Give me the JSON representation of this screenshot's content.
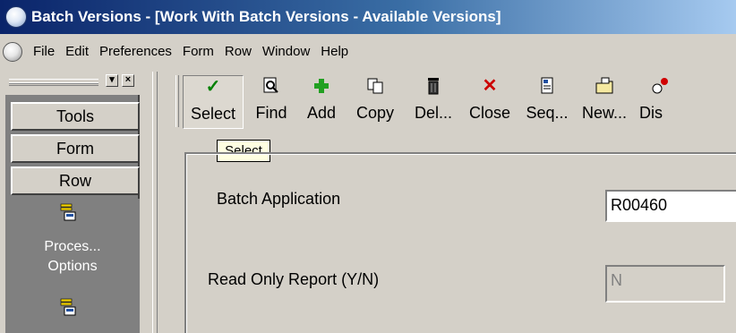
{
  "window": {
    "title": "Batch Versions - [Work With Batch Versions - Available Versions]"
  },
  "menubar": {
    "items": [
      "File",
      "Edit",
      "Preferences",
      "Form",
      "Row",
      "Window",
      "Help"
    ]
  },
  "left_panel": {
    "tabs": [
      "Tools",
      "Form",
      "Row"
    ],
    "items": [
      {
        "label_line1": "Proces...",
        "label_line2": "Options",
        "icon": "processing-options-icon"
      },
      {
        "label_line1": "",
        "label_line2": "",
        "icon": "processing-options-icon"
      }
    ]
  },
  "toolbar": {
    "buttons": [
      {
        "label": "Select",
        "icon": "check-icon",
        "color": "#008000"
      },
      {
        "label": "Find",
        "icon": "find-icon",
        "color": "#000000"
      },
      {
        "label": "Add",
        "icon": "add-icon",
        "color": "#1a8f1a"
      },
      {
        "label": "Copy",
        "icon": "copy-icon",
        "color": "#000000"
      },
      {
        "label": "Del...",
        "icon": "delete-icon",
        "color": "#000000"
      },
      {
        "label": "Close",
        "icon": "close-icon",
        "color": "#cc0000"
      },
      {
        "label": "Seq...",
        "icon": "sequence-icon",
        "color": "#000000"
      },
      {
        "label": "New...",
        "icon": "new-folder-icon",
        "color": "#000000"
      },
      {
        "label": "Dis",
        "icon": "display-icon",
        "color": "#000000"
      }
    ]
  },
  "tooltip": {
    "text": "Select"
  },
  "form": {
    "batch_application_label": "Batch Application",
    "batch_application_value": "R00460",
    "read_only_label": "Read Only Report (Y/N)",
    "read_only_value": "N"
  }
}
